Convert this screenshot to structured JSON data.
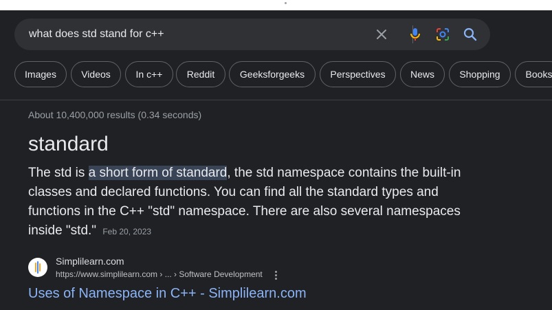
{
  "search": {
    "query": "what does std stand for c++",
    "icons": [
      "close-icon",
      "microphone-icon",
      "lens-icon",
      "search-icon"
    ]
  },
  "chips": [
    {
      "label": "Images"
    },
    {
      "label": "Videos"
    },
    {
      "label": "In c++"
    },
    {
      "label": "Reddit"
    },
    {
      "label": "Geeksforgeeks"
    },
    {
      "label": "Perspectives"
    },
    {
      "label": "News"
    },
    {
      "label": "Shopping"
    },
    {
      "label": "Books"
    }
  ],
  "result_stats": "About 10,400,000 results (0.34 seconds)",
  "featured": {
    "answer": "standard",
    "snippet_before": "The std is ",
    "snippet_highlight": "a short form of standard",
    "snippet_after": ", the std namespace contains the built-in classes and declared functions. You can find all the standard types and functions in the C++ \"std\" namespace. There are also several namespaces inside \"std.\"",
    "date": "Feb 20, 2023"
  },
  "source": {
    "site_name": "Simplilearn.com",
    "url": "https://www.simplilearn.com › ... › Software Development",
    "title": "Uses of Namespace in C++ - Simplilearn.com"
  },
  "colors": {
    "background": "#202124",
    "search_bg": "#303134",
    "link": "#8ab4f8",
    "highlight": "#394457",
    "mic_blue": "#4285f4",
    "mic_yellow": "#fbbc04",
    "lens_red": "#ea4335",
    "lens_green": "#34a853"
  }
}
